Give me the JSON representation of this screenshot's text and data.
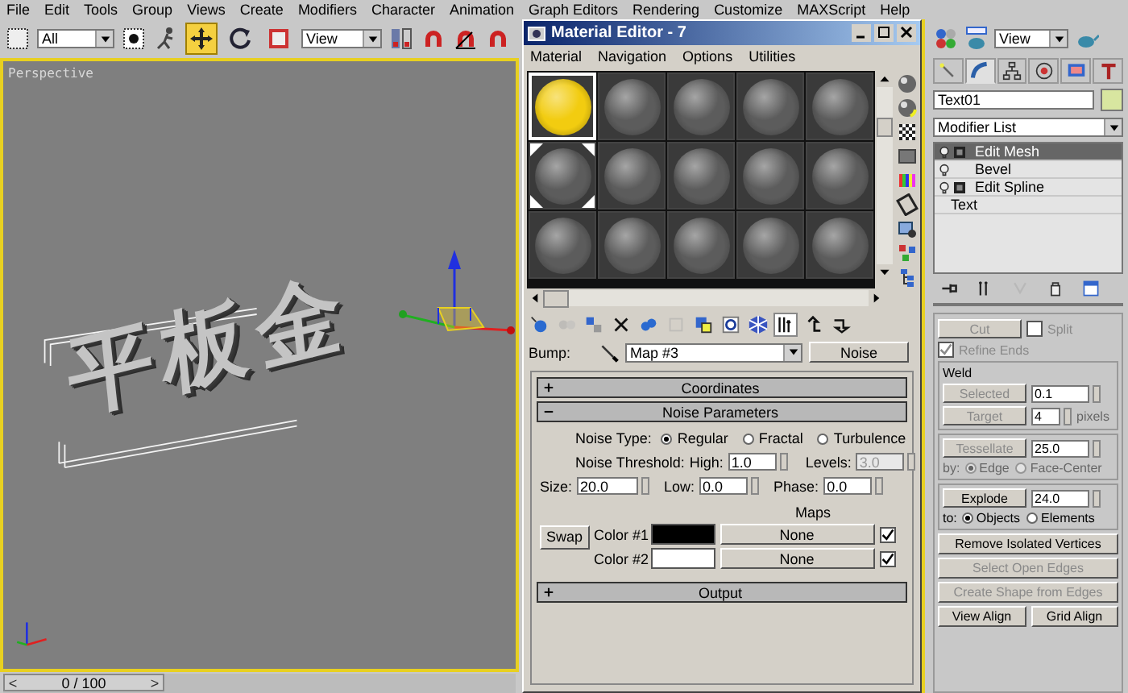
{
  "main_menu": {
    "items": [
      "File",
      "Edit",
      "Tools",
      "Group",
      "Views",
      "Create",
      "Modifiers",
      "Character",
      "Animation",
      "Graph Editors",
      "Rendering",
      "Customize",
      "MAXScript",
      "Help"
    ]
  },
  "toolbar": {
    "selection_filter": "All",
    "reference_coord": "View",
    "tools": [
      {
        "kind": "move",
        "selected": true
      },
      {
        "kind": "rotate",
        "selected": false
      },
      {
        "kind": "scale",
        "selected": false
      }
    ]
  },
  "viewport": {
    "label": "Perspective",
    "text_object": "平板金"
  },
  "time_slider": {
    "prev": "<",
    "position": "0 / 100",
    "next": ">",
    "level": 0
  },
  "material_editor": {
    "title": "Material Editor - 7",
    "menu": [
      "Material",
      "Navigation",
      "Options",
      "Utilities"
    ],
    "slots": [
      {
        "color": "#f2cc10",
        "selected": true,
        "hot": false
      },
      {
        "color": "#5c5c5c",
        "selected": false,
        "hot": false
      },
      {
        "color": "#5c5c5c",
        "selected": false,
        "hot": false
      },
      {
        "color": "#5c5c5c",
        "selected": false,
        "hot": false
      },
      {
        "color": "#5c5c5c",
        "selected": false,
        "hot": false
      },
      {
        "color": "#5c5c5c",
        "selected": false,
        "hot": true
      },
      {
        "color": "#5c5c5c",
        "selected": false,
        "hot": false
      },
      {
        "color": "#5c5c5c",
        "selected": false,
        "hot": false
      },
      {
        "color": "#5c5c5c",
        "selected": false,
        "hot": false
      },
      {
        "color": "#5c5c5c",
        "selected": false,
        "hot": false
      },
      {
        "color": "#5c5c5c",
        "selected": false,
        "hot": false
      },
      {
        "color": "#5c5c5c",
        "selected": false,
        "hot": false
      },
      {
        "color": "#5c5c5c",
        "selected": false,
        "hot": false
      },
      {
        "color": "#5c5c5c",
        "selected": false,
        "hot": false
      },
      {
        "color": "#5c5c5c",
        "selected": false,
        "hot": false
      }
    ],
    "bump": {
      "label": "Bump:",
      "map": "Map #3",
      "type": "Noise"
    },
    "rollouts": [
      {
        "title": "Coordinates",
        "expanded": false
      },
      {
        "title": "Noise Parameters",
        "expanded": true
      },
      {
        "title": "Output",
        "expanded": false
      }
    ],
    "noise": {
      "type_label": "Noise Type:",
      "types": [
        {
          "label": "Regular",
          "selected": true
        },
        {
          "label": "Fractal",
          "selected": false
        },
        {
          "label": "Turbulence",
          "selected": false
        }
      ],
      "threshold_label": "Noise Threshold:",
      "high_label": "High:",
      "high": "1.0",
      "levels_label": "Levels:",
      "levels": "3.0",
      "levels_disabled": true,
      "size_label": "Size:",
      "size": "20.0",
      "low_label": "Low:",
      "low": "0.0",
      "phase_label": "Phase:",
      "phase": "0.0",
      "maps_label": "Maps",
      "swap": "Swap",
      "colors": [
        {
          "label": "Color #1",
          "color": "#000000",
          "map": "None",
          "checked": true
        },
        {
          "label": "Color #2",
          "color": "#ffffff",
          "map": "None",
          "checked": true
        }
      ]
    }
  },
  "command_panel": {
    "view": "View",
    "tabs": [
      {
        "kind": "create",
        "selected": false
      },
      {
        "kind": "modify",
        "selected": true
      },
      {
        "kind": "hierarchy",
        "selected": false
      },
      {
        "kind": "motion",
        "selected": false
      },
      {
        "kind": "display",
        "selected": false
      },
      {
        "kind": "utilities",
        "selected": false
      }
    ],
    "object_name": "Text01",
    "modifier_list": "Modifier List",
    "stack": [
      {
        "label": "Edit Mesh",
        "kind": "modifier",
        "selected": true,
        "subobject": true
      },
      {
        "label": "Bevel",
        "kind": "modifier",
        "selected": false,
        "subobject": false
      },
      {
        "label": "Edit Spline",
        "kind": "modifier",
        "selected": false,
        "subobject": true
      },
      {
        "label": "Text",
        "kind": "base",
        "selected": false
      }
    ],
    "edit_geometry": {
      "cut": {
        "label": "Cut",
        "disabled": true
      },
      "split": {
        "label": "Split",
        "checked": false,
        "disabled": true
      },
      "refine_ends": {
        "label": "Refine Ends",
        "checked": true,
        "disabled": true
      },
      "weld": {
        "title": "Weld",
        "selected_label": "Selected",
        "selected_value": "0.1",
        "target_label": "Target",
        "target_value": "4",
        "target_unit": "pixels",
        "disabled": true
      },
      "tessellate": {
        "label": "Tessellate",
        "value": "25.0",
        "by_label": "by:",
        "disabled": true,
        "options": [
          {
            "label": "Edge",
            "selected": true
          },
          {
            "label": "Face-Center",
            "selected": false
          }
        ]
      },
      "explode": {
        "label": "Explode",
        "value": "24.0",
        "to_label": "to:",
        "disabled": false,
        "options": [
          {
            "label": "Objects",
            "selected": true
          },
          {
            "label": "Elements",
            "selected": false
          }
        ]
      },
      "buttons": [
        {
          "label": "Remove Isolated Vertices",
          "disabled": false
        },
        {
          "label": "Select Open Edges",
          "disabled": true
        },
        {
          "label": "Create Shape from Edges",
          "disabled": true
        }
      ],
      "align": [
        {
          "label": "View Align",
          "disabled": false
        },
        {
          "label": "Grid Align",
          "disabled": false
        }
      ]
    }
  }
}
